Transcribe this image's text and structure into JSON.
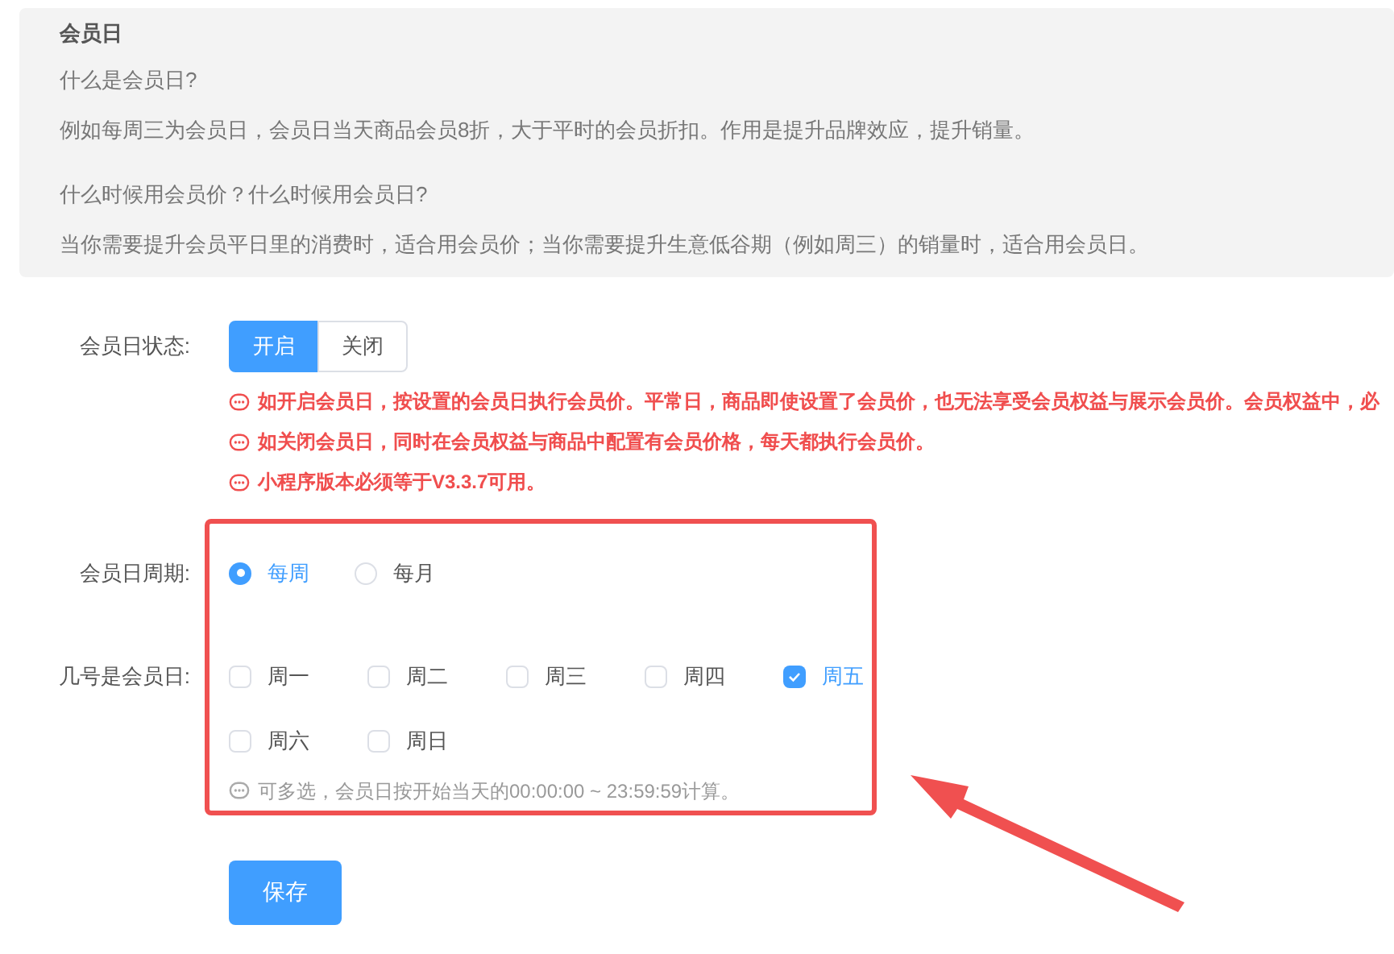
{
  "info": {
    "title": "会员日",
    "paragraphs": [
      {
        "kind": "question",
        "text": "什么是会员日?"
      },
      {
        "kind": "answer",
        "text": "例如每周三为会员日，会员日当天商品会员8折，大于平时的会员折扣。作用是提升品牌效应，提升销量。"
      },
      {
        "kind": "question",
        "text": "什么时候用会员价？什么时候用会员日?"
      },
      {
        "kind": "answer",
        "text": "当你需要提升会员平日里的消费时，适合用会员价；当你需要提升生意低谷期（例如周三）的销量时，适合用会员日。"
      }
    ]
  },
  "status": {
    "label": "会员日状态:",
    "options": [
      {
        "label": "开启",
        "selected": true
      },
      {
        "label": "关闭",
        "selected": false
      }
    ],
    "notes": [
      "如开启会员日，按设置的会员日执行会员价。平常日，商品即使设置了会员价，也无法享受会员权益与展示会员价。会员权益中，必",
      "如关闭会员日，同时在会员权益与商品中配置有会员价格，每天都执行会员价。",
      "小程序版本必须等于V3.3.7可用。"
    ]
  },
  "period": {
    "label": "会员日周期:",
    "options": [
      {
        "label": "每周",
        "selected": true
      },
      {
        "label": "每月",
        "selected": false
      }
    ]
  },
  "days": {
    "label": "几号是会员日:",
    "options": [
      {
        "label": "周一",
        "checked": false
      },
      {
        "label": "周二",
        "checked": false
      },
      {
        "label": "周三",
        "checked": false
      },
      {
        "label": "周四",
        "checked": false
      },
      {
        "label": "周五",
        "checked": true
      },
      {
        "label": "周六",
        "checked": false
      },
      {
        "label": "周日",
        "checked": false
      }
    ],
    "hint": "可多选，会员日按开始当天的00:00:00 ~ 23:59:59计算。"
  },
  "save_button": "保存"
}
